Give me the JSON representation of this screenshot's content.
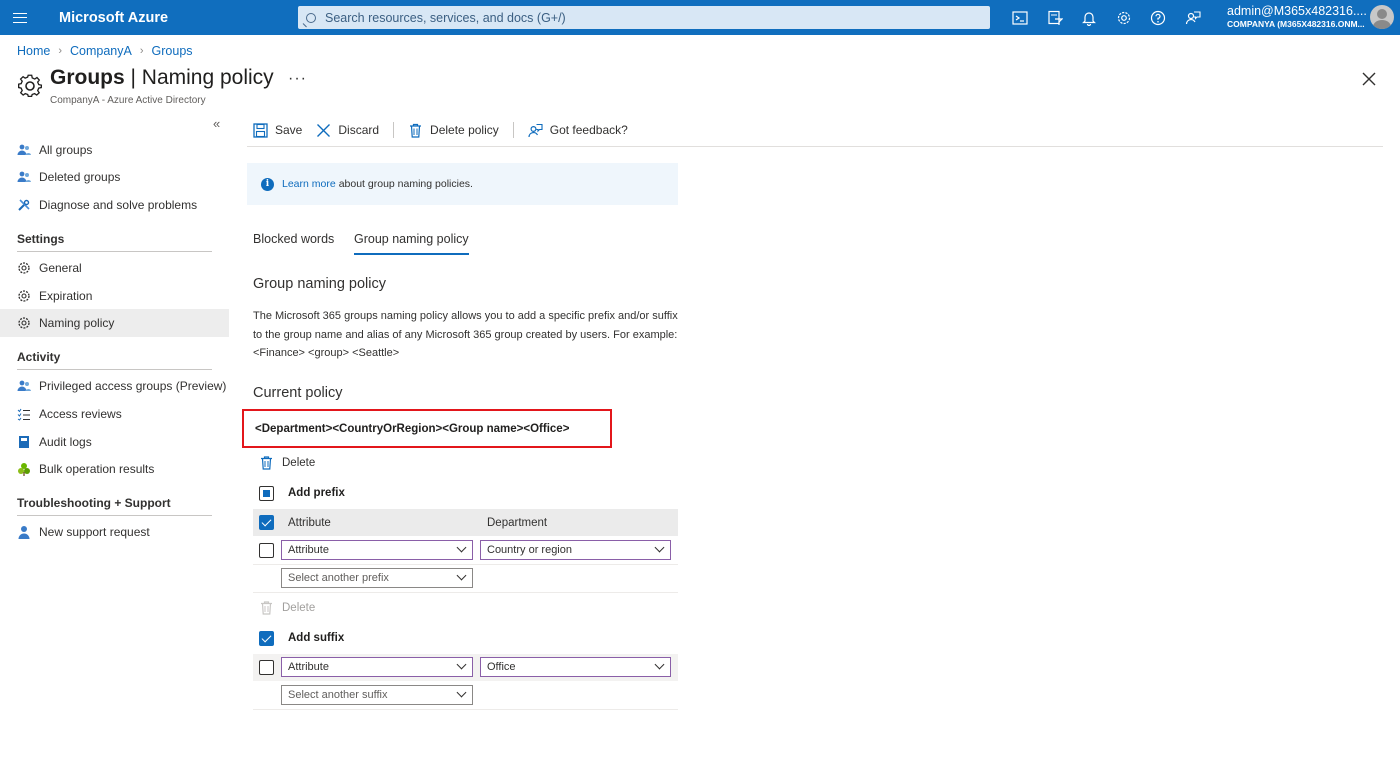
{
  "topbar": {
    "brand": "Microsoft Azure",
    "search_placeholder": "Search resources, services, and docs (G+/)",
    "icons": [
      "cloud-shell-icon",
      "directory-filter-icon",
      "notifications-icon",
      "settings-icon",
      "help-icon",
      "feedback-icon"
    ],
    "account_user": "admin@M365x482316....",
    "account_tenant": "COMPANYA (M365X482316.ONM..."
  },
  "breadcrumb": [
    "Home",
    "CompanyA",
    "Groups"
  ],
  "header": {
    "title_bold": "Groups",
    "title_rest": " | Naming policy",
    "subtitle": "CompanyA - Azure Active Directory",
    "more": "···"
  },
  "sidebar": {
    "collapse": "«",
    "top_items": [
      {
        "label": "All groups",
        "icon": "groups-icon"
      },
      {
        "label": "Deleted groups",
        "icon": "groups-icon"
      },
      {
        "label": "Diagnose and solve problems",
        "icon": "wrench-icon"
      }
    ],
    "settings_heading": "Settings",
    "settings_items": [
      {
        "label": "General",
        "icon": "gear-icon"
      },
      {
        "label": "Expiration",
        "icon": "gear-icon"
      },
      {
        "label": "Naming policy",
        "icon": "gear-icon"
      }
    ],
    "activity_heading": "Activity",
    "activity_items": [
      {
        "label": "Privileged access groups (Preview)",
        "icon": "groups-icon"
      },
      {
        "label": "Access reviews",
        "icon": "list-icon"
      },
      {
        "label": "Audit logs",
        "icon": "book-icon"
      },
      {
        "label": "Bulk operation results",
        "icon": "tree-icon"
      }
    ],
    "support_heading": "Troubleshooting + Support",
    "support_items": [
      {
        "label": "New support request",
        "icon": "person-icon"
      }
    ]
  },
  "commands": {
    "save": "Save",
    "discard": "Discard",
    "delete_policy": "Delete policy",
    "feedback": "Got feedback?"
  },
  "info": {
    "link": "Learn more",
    "text": "about group naming policies."
  },
  "tabs": [
    "Blocked words",
    "Group naming policy"
  ],
  "content": {
    "heading": "Group naming policy",
    "description": "The Microsoft 365 groups naming policy allows you to add a specific prefix and/or suffix to the group name and alias of any Microsoft 365 group created by users. For example: <Finance> <group> <Seattle>",
    "current_policy_heading": "Current policy",
    "current_policy": "<Department><CountryOrRegion><Group name><Office>",
    "delete_label": "Delete",
    "delete_label_2": "Delete",
    "add_prefix": "Add prefix",
    "prefix_header": {
      "col1": "Attribute",
      "col2": "Department"
    },
    "prefix_row": {
      "type": "Attribute",
      "value": "Country or region"
    },
    "prefix_placeholder": "Select another prefix",
    "add_suffix": "Add suffix",
    "suffix_row": {
      "type": "Attribute",
      "value": "Office"
    },
    "suffix_placeholder": "Select another suffix"
  },
  "colors": {
    "accent": "#0f6cbd",
    "highlight_border": "#e3161b",
    "topbar": "#106ebe"
  }
}
